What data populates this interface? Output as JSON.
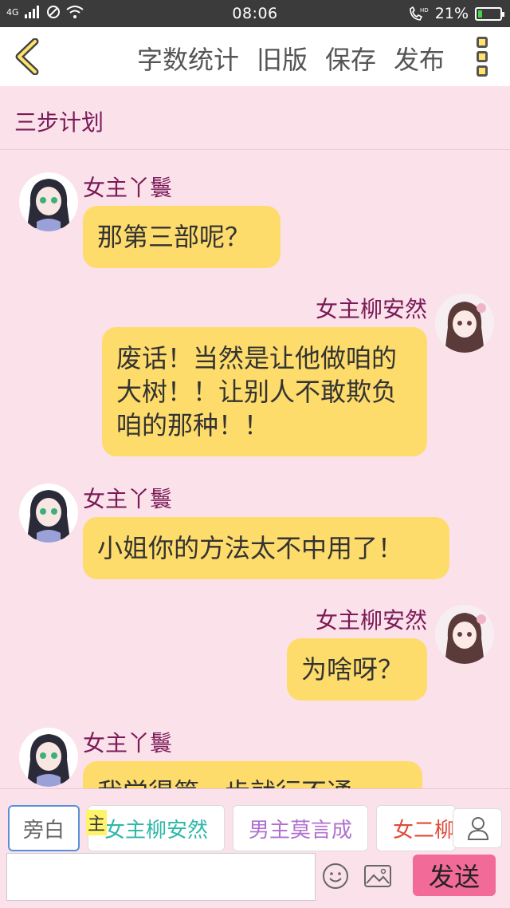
{
  "status_bar": {
    "network": "4G",
    "time": "08:06",
    "hd": "HD",
    "battery_percent": "21%",
    "battery_level": 0.21
  },
  "header": {
    "actions": [
      "字数统计",
      "旧版",
      "保存",
      "发布"
    ]
  },
  "title": "三步计划",
  "messages": [
    {
      "sender": "女主丫鬟",
      "side": "left",
      "text": "那第三部呢？"
    },
    {
      "sender": "女主柳安然",
      "side": "right",
      "text": "废话！当然是让他做咱的大树！！让别人不敢欺负咱的那种！！"
    },
    {
      "sender": "女主丫鬟",
      "side": "left",
      "text": "小姐你的方法太不中用了！"
    },
    {
      "sender": "女主柳安然",
      "side": "right",
      "text": "为啥呀？"
    },
    {
      "sender": "女主丫鬟",
      "side": "left",
      "text": "我觉得第一步就行不通"
    }
  ],
  "role_chips": [
    {
      "label": "旁白",
      "color": "#666666"
    },
    {
      "label": "女主柳安然",
      "color": "#2cb8a8"
    },
    {
      "label": "男主莫言成",
      "color": "#b070d0"
    },
    {
      "label": "女二柳",
      "color": "#e04a3a"
    }
  ],
  "zhu_mark": "主",
  "input": {
    "value": "",
    "placeholder": ""
  },
  "send_label": "发送",
  "colors": {
    "bubble": "#fedc6b",
    "name": "#7a1a57",
    "send": "#f26a98",
    "background": "#fbe1ea"
  }
}
